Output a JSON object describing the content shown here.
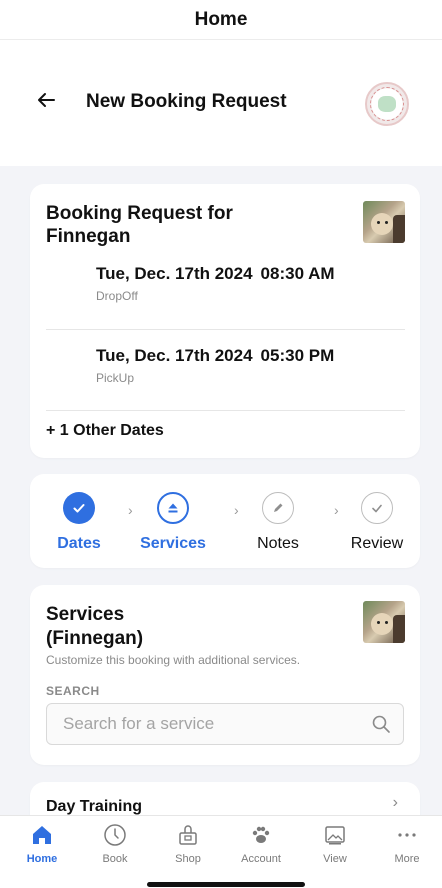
{
  "topbar": {
    "title": "Home"
  },
  "header": {
    "title": "New Booking Request"
  },
  "booking": {
    "title": "Booking Request for Finnegan",
    "dates": [
      {
        "date": "Tue, Dec. 17th 2024",
        "time": "08:30 AM",
        "type": "DropOff"
      },
      {
        "date": "Tue, Dec. 17th 2024",
        "time": "05:30 PM",
        "type": "PickUp"
      }
    ],
    "other_dates": "+ 1 Other Dates"
  },
  "steps": [
    {
      "label": "Dates",
      "state": "done",
      "icon": "check-icon"
    },
    {
      "label": "Services",
      "state": "current",
      "icon": "eject-icon"
    },
    {
      "label": "Notes",
      "state": "todo",
      "icon": "pencil-icon"
    },
    {
      "label": "Review",
      "state": "todo",
      "icon": "check-icon"
    }
  ],
  "services": {
    "title": "Services (Finnegan)",
    "description": "Customize this booking with additional services.",
    "search_label": "SEARCH",
    "search_placeholder": "Search for a service"
  },
  "day_training": {
    "title": "Day Training"
  },
  "tabbar": [
    {
      "label": "Home",
      "icon": "home-icon",
      "active": true
    },
    {
      "label": "Book",
      "icon": "clock-icon",
      "active": false
    },
    {
      "label": "Shop",
      "icon": "shop-icon",
      "active": false
    },
    {
      "label": "Account",
      "icon": "paw-icon",
      "active": false
    },
    {
      "label": "View",
      "icon": "image-icon",
      "active": false
    },
    {
      "label": "More",
      "icon": "more-icon",
      "active": false
    }
  ],
  "colors": {
    "accent": "#2f6fe0",
    "muted": "#8a8a8a",
    "background": "#f3f4f8"
  }
}
